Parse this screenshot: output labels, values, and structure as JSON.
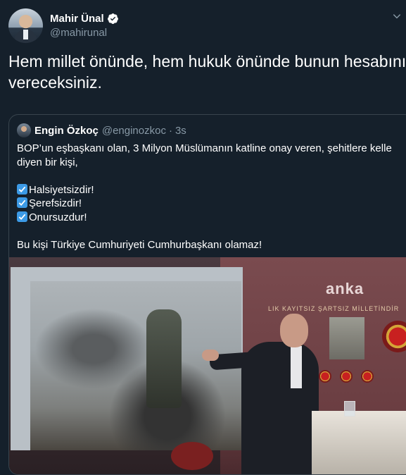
{
  "tweet": {
    "display_name": "Mahir Ünal",
    "handle": "@mahirunal",
    "text": "Hem millet önünde, hem hukuk önünde bunun hesabını vereceksiniz.",
    "verified": true,
    "icons": {
      "verified": "verified-badge-icon",
      "more": "chevron-down-icon"
    }
  },
  "quote": {
    "display_name": "Engin Özkoç",
    "handle": "@enginozkoc",
    "separator": "·",
    "time": "3s",
    "lines": [
      "BOP’un eşbaşkanı olan, 3 Milyon Müslümanın katline onay veren, şehitlere kelle diyen bir kişi,",
      ""
    ],
    "checklist": [
      "Halsiyetsizdir!",
      "Şerefsizdir!",
      "Onursuzdur!"
    ],
    "closing": "Bu kişi Türkiye Cumhuriyeti Cumhurbaşkanı olamaz!",
    "media": {
      "watermark": "anka",
      "banner": "LIK KAYITSIZ ŞARTSIZ MİLLETİNDİR"
    }
  },
  "colors": {
    "background": "#15202b",
    "secondary_text": "#8899a6",
    "border": "#38444d",
    "accent": "#1da1f2"
  }
}
